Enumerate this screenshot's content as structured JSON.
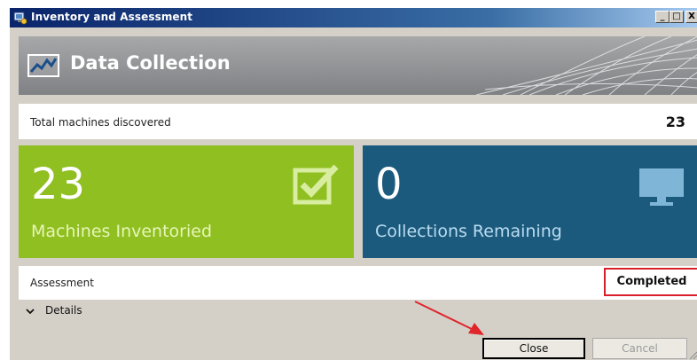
{
  "window": {
    "title": "Inventory and Assessment",
    "icon": "app-icon",
    "controls": {
      "minimize": "_",
      "maximize": "□",
      "close": "X"
    }
  },
  "banner": {
    "icon": "chart-line-icon",
    "title": "Data Collection"
  },
  "summary": {
    "label": "Total machines discovered",
    "value": "23"
  },
  "tiles": [
    {
      "count": "23",
      "label": "Machines Inventoried",
      "icon": "checkbox-checked-icon",
      "color": "#8fbf21"
    },
    {
      "count": "0",
      "label": "Collections Remaining",
      "icon": "monitor-icon",
      "color": "#1c5a7d"
    }
  ],
  "assessment": {
    "label": "Assessment",
    "status": "Completed",
    "highlight_color": "#d9202a"
  },
  "details": {
    "icon": "chevron-down-icon",
    "label": "Details"
  },
  "buttons": {
    "close": "Close",
    "cancel": "Cancel"
  },
  "annotation": {
    "arrow_color": "#e0252b"
  }
}
